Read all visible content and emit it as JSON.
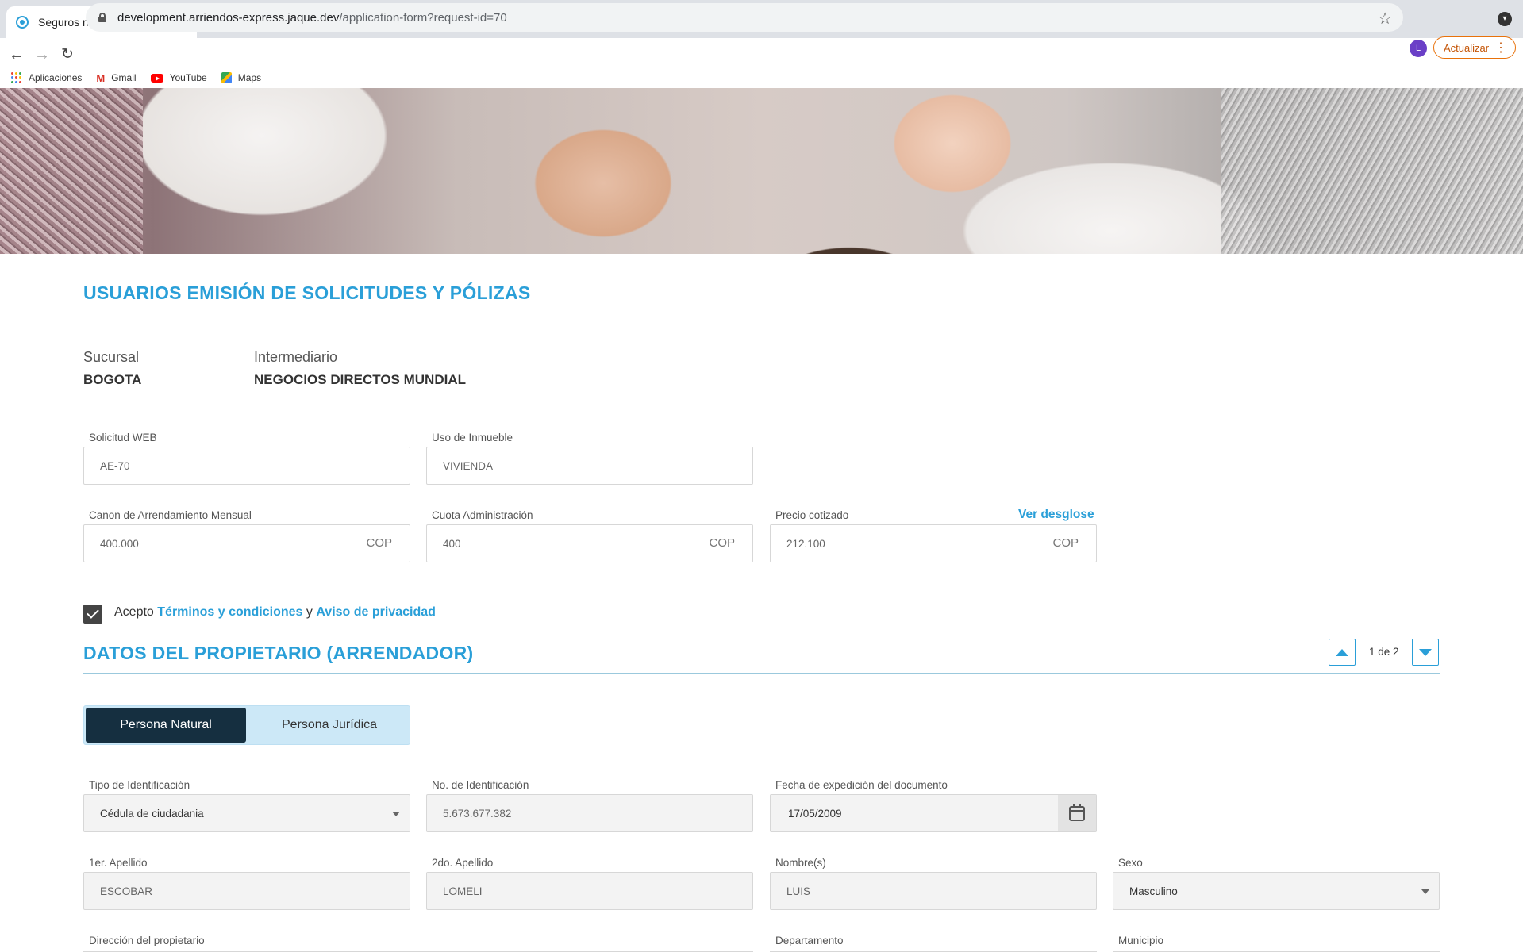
{
  "browser": {
    "tab_title": "Seguros mundial",
    "url_host": "development.arriendos-express.jaque.dev",
    "url_path": "/application-form?request-id=70",
    "avatar_letter": "L",
    "update_label": "Actualizar",
    "bookmarks": [
      {
        "label": "Aplicaciones",
        "icon": "apps-icon"
      },
      {
        "label": "Gmail",
        "icon": "gmail-icon"
      },
      {
        "label": "YouTube",
        "icon": "youtube-icon"
      },
      {
        "label": "Maps",
        "icon": "maps-icon"
      }
    ]
  },
  "section1": {
    "title": "USUARIOS EMISIÓN DE SOLICITUDES Y PÓLIZAS",
    "sucursal_label": "Sucursal",
    "sucursal_value": "BOGOTA",
    "intermediario_label": "Intermediario",
    "intermediario_value": "NEGOCIOS DIRECTOS MUNDIAL"
  },
  "request": {
    "solicitud_label": "Solicitud WEB",
    "solicitud_value": "AE-70",
    "uso_label": "Uso de Inmueble",
    "uso_value": "VIVIENDA",
    "canon_label": "Canon de Arrendamiento Mensual",
    "canon_value": "400.000",
    "cuota_label": "Cuota Administración",
    "cuota_value": "400",
    "precio_label": "Precio cotizado",
    "precio_value": "212.100",
    "currency": "COP",
    "ver_desglose": "Ver desglose"
  },
  "terms": {
    "acepto": "Acepto",
    "terminos": "Términos y condiciones",
    "y": "y",
    "aviso": "Aviso de privacidad",
    "checked": true
  },
  "section2": {
    "title": "DATOS DEL PROPIETARIO (ARRENDADOR)",
    "pager": "1 de 2",
    "persona_natural": "Persona Natural",
    "persona_juridica": "Persona Jurídica"
  },
  "owner": {
    "tipo_id_label": "Tipo de Identificación",
    "tipo_id_value": "Cédula de ciudadania",
    "no_id_label": "No. de Identificación",
    "no_id_value": "5.673.677.382",
    "fecha_label": "Fecha de expedición del documento",
    "fecha_value": "17/05/2009",
    "apellido1_label": "1er. Apellido",
    "apellido1_value": "ESCOBAR",
    "apellido2_label": "2do. Apellido",
    "apellido2_value": "LOMELI",
    "nombres_label": "Nombre(s)",
    "nombres_value": "LUIS",
    "sexo_label": "Sexo",
    "sexo_value": "Masculino",
    "direccion_label": "Dirección del propietario",
    "departamento_label": "Departamento",
    "municipio_label": "Municipio"
  },
  "colors": {
    "accent": "#2a9fd8",
    "dark_toggle": "#152f40",
    "update_orange": "#e8710a"
  }
}
